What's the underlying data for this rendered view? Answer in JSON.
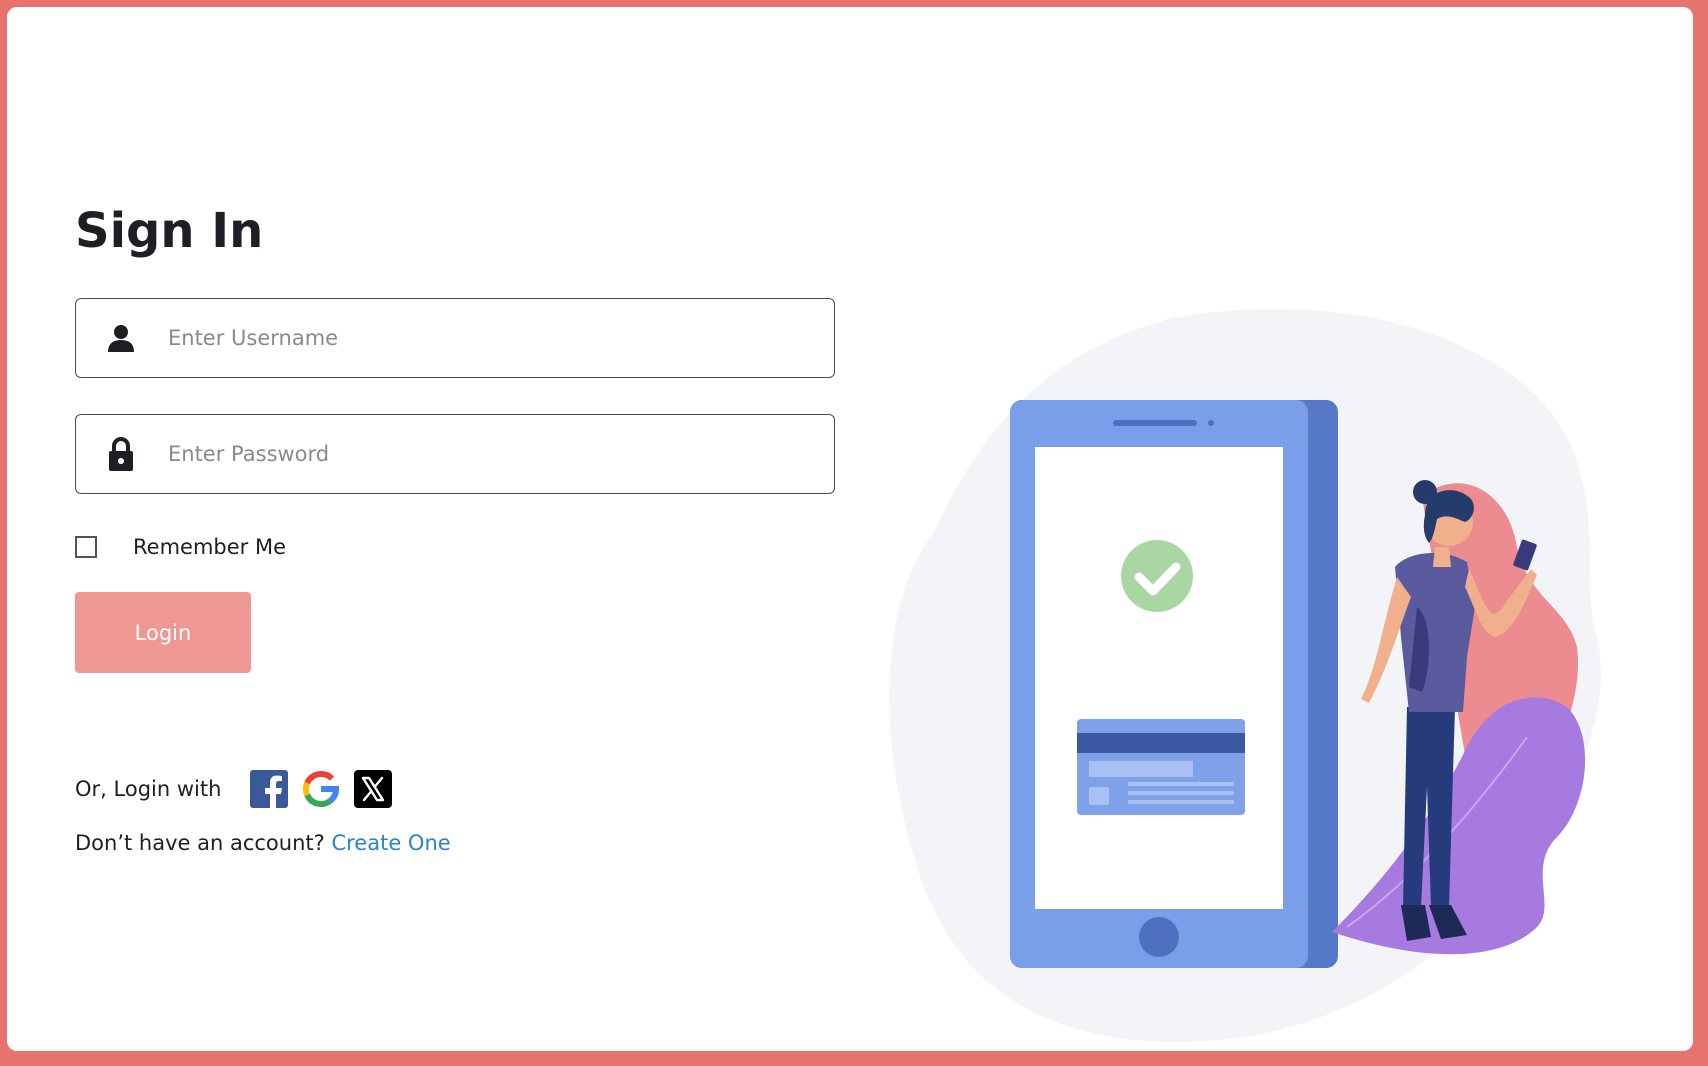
{
  "signin": {
    "title": "Sign In",
    "username_placeholder": "Enter Username",
    "password_placeholder": "Enter Password",
    "remember_label": "Remember Me",
    "login_label": "Login",
    "social_label": "Or, Login with",
    "social_providers": [
      "facebook-icon",
      "google-icon",
      "x-icon"
    ],
    "signup_prompt": "Don’t have an account?",
    "signup_link": "Create One"
  },
  "colors": {
    "background": "#e6736e",
    "login_button": "#ef9793",
    "link": "#2a86c9",
    "title": "#1d1f24"
  }
}
